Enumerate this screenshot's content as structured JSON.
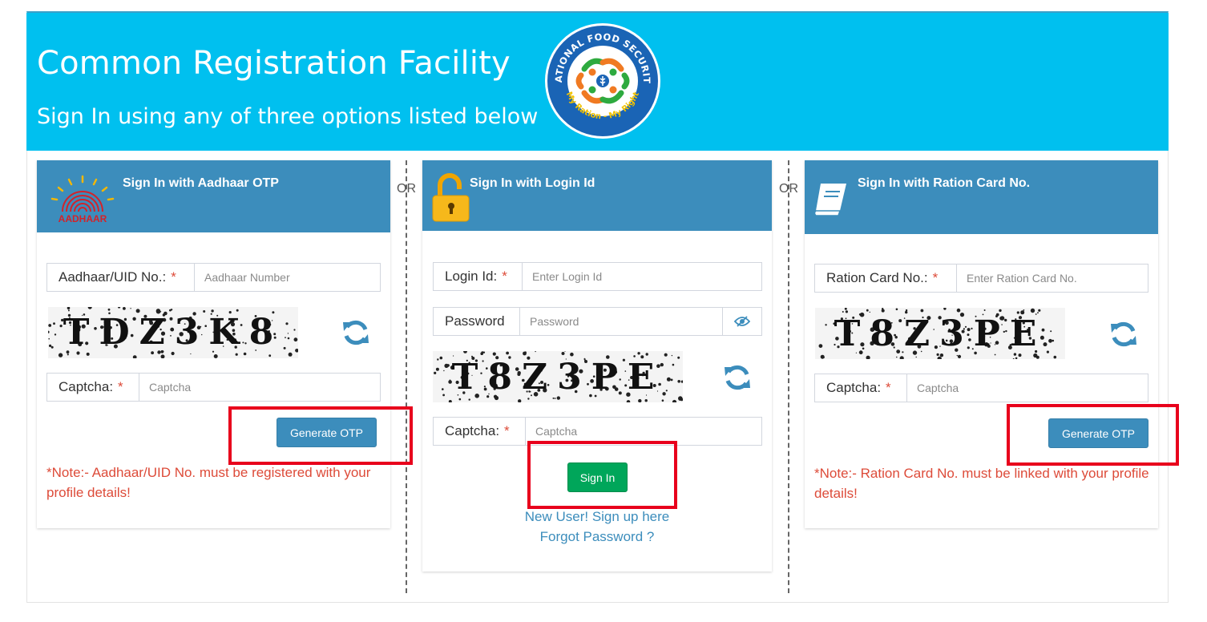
{
  "banner": {
    "title": "Common Registration Facility",
    "subtitle": "Sign In using any of three options listed below",
    "logo_top_text": "NATIONAL FOOD SECURITY",
    "logo_bottom_text": "My Ration - My Right"
  },
  "separator_text": "OR",
  "aadhaar_panel": {
    "title": "Sign In with Aadhaar OTP",
    "logo_text": "AADHAAR",
    "uid_label": "Aadhaar/UID No.:",
    "uid_placeholder": "Aadhaar Number",
    "captcha_text": "TDZ3K8",
    "captcha_label": "Captcha:",
    "captcha_placeholder": "Captcha",
    "button_label": "Generate OTP",
    "note": "*Note:- Aadhaar/UID No. must be registered with your profile details!"
  },
  "login_panel": {
    "title": "Sign In with Login Id",
    "login_label": "Login Id:",
    "login_placeholder": "Enter Login Id",
    "password_label": "Password",
    "password_placeholder": "Password",
    "captcha_text": "T8Z3PE",
    "captcha_label": "Captcha:",
    "captcha_placeholder": "Captcha",
    "button_label": "Sign In",
    "signup_link": "New User! Sign up here",
    "forgot_link": "Forgot Password ?"
  },
  "ration_panel": {
    "title": "Sign In with Ration Card No.",
    "card_label": "Ration Card No.:",
    "card_placeholder": "Enter Ration Card No.",
    "captcha_text": "T8Z3PE",
    "captcha_label": "Captcha:",
    "captcha_placeholder": "Captcha",
    "button_label": "Generate OTP",
    "note": "*Note:- Ration Card No. must be linked with your profile details!"
  },
  "colors": {
    "banner": "#00c0ef",
    "panel_header": "#3c8dbc",
    "primary_button": "#3c8dbc",
    "success_button": "#00a65a",
    "required_and_note": "#dd4b39",
    "highlight_box": "#e8001c"
  },
  "icons": {
    "aadhaar": "aadhaar-fingerprint-logo",
    "login": "unlocked-padlock-icon",
    "ration": "book-icon",
    "refresh": "refresh-icon",
    "password_toggle": "eye-slash-icon"
  }
}
